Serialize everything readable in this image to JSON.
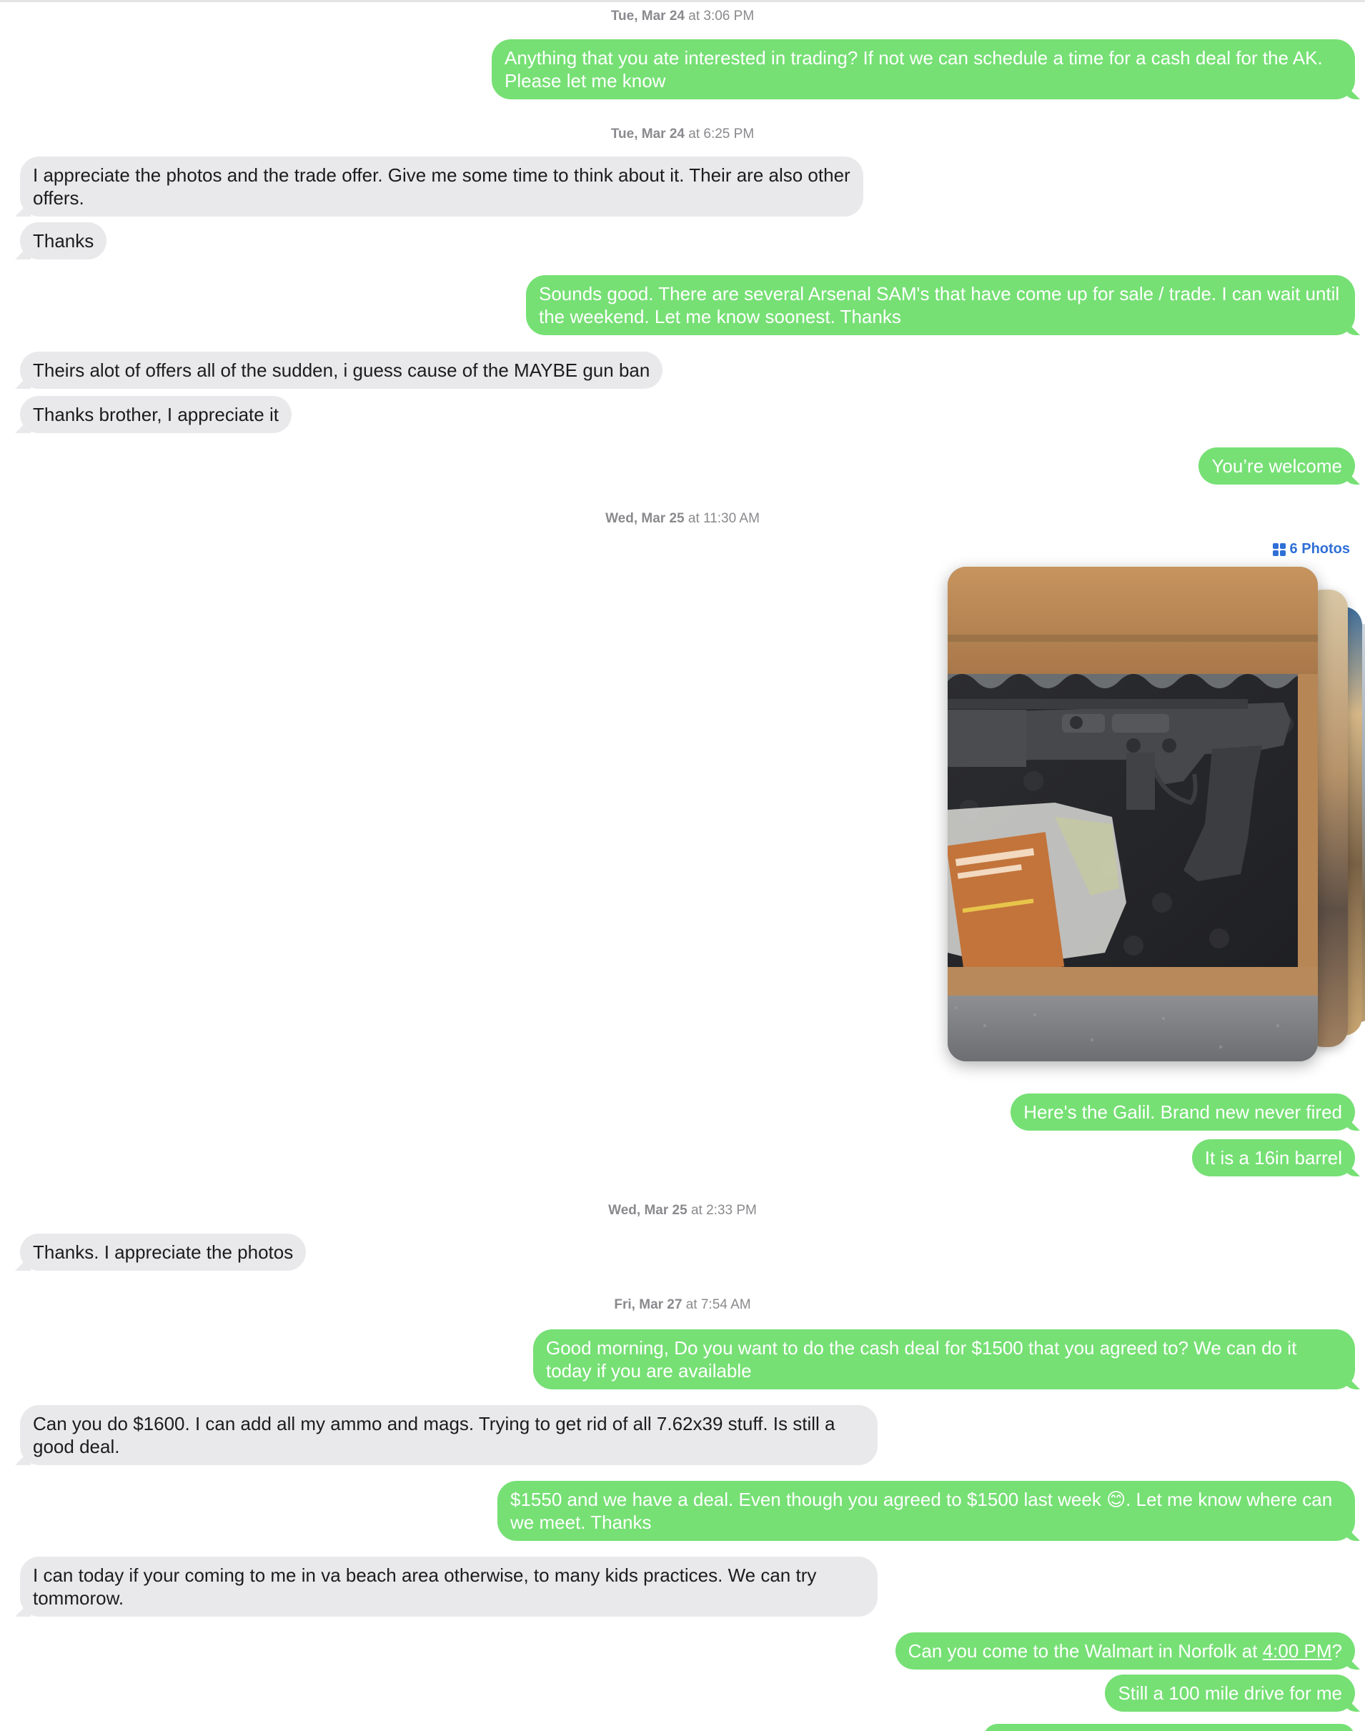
{
  "messages": [
    {
      "id": "ts1",
      "kind": "timestamp",
      "day": "Tue, Mar 24",
      "time": "at 3:06 PM"
    },
    {
      "id": "m1",
      "kind": "outgoing",
      "text": "Anything that you ate interested in trading? If not we can schedule a time for a cash deal for the AK. Please let me know"
    },
    {
      "id": "ts2",
      "kind": "timestamp",
      "day": "Tue, Mar 24",
      "time": "at 6:25 PM"
    },
    {
      "id": "m2",
      "kind": "incoming",
      "text": "I appreciate the photos and the trade offer. Give me some time to think about it. Their are also other offers."
    },
    {
      "id": "m3",
      "kind": "incoming",
      "text": "Thanks"
    },
    {
      "id": "m4",
      "kind": "outgoing",
      "text": "Sounds good. There are several Arsenal SAM's that have come up for sale / trade. I can wait until the weekend. Let me know soonest. Thanks"
    },
    {
      "id": "m5",
      "kind": "incoming",
      "text": "Theirs alot of offers all of the sudden, i guess cause of the MAYBE gun ban"
    },
    {
      "id": "m6",
      "kind": "incoming",
      "text": "Thanks brother, I appreciate it"
    },
    {
      "id": "m7",
      "kind": "outgoing",
      "text": "You’re welcome"
    },
    {
      "id": "ts3",
      "kind": "timestamp",
      "day": "Wed, Mar 25",
      "time": "at 11:30 AM"
    },
    {
      "id": "m8",
      "kind": "outgoing",
      "text": "Here's the Galil. Brand new never fired"
    },
    {
      "id": "m9",
      "kind": "outgoing",
      "text": "It is a 16in barrel"
    },
    {
      "id": "ts4",
      "kind": "timestamp",
      "day": "Wed, Mar 25",
      "time": "at 2:33 PM"
    },
    {
      "id": "m10",
      "kind": "incoming",
      "text": "Thanks. I appreciate the photos"
    },
    {
      "id": "ts5",
      "kind": "timestamp",
      "day": "Fri, Mar 27",
      "time": "at 7:54 AM"
    },
    {
      "id": "m11",
      "kind": "outgoing",
      "text": "Good morning, Do you want to do the cash deal for $1500 that you agreed to? We can do it today if you are available"
    },
    {
      "id": "m12",
      "kind": "incoming",
      "text": "Can you do $1600. I can add all my ammo and mags. Trying to get rid of all 7.62x39 stuff.  Is still a good deal."
    },
    {
      "id": "m13",
      "kind": "outgoing",
      "text": "$1550 and we have a deal. Even though you agreed to $1500 last week 😊. Let me know where can we meet. Thanks"
    },
    {
      "id": "m14",
      "kind": "incoming",
      "text": "I can today if your coming to me in va beach area otherwise, to many kids practices. We can try tommorow."
    },
    {
      "id": "m15",
      "kind": "outgoing",
      "text_before": "Can you come to the Walmart in Norfolk at ",
      "link": "4:00 PM",
      "text_after": "?"
    },
    {
      "id": "m16",
      "kind": "outgoing",
      "text": "Still a 100 mile drive for me"
    }
  ],
  "photo_group": {
    "label": "6 Photos",
    "icon": "grid-icon"
  },
  "colors": {
    "outgoing_bubble": "#76e074",
    "incoming_bubble": "#e9e9eb",
    "timestamp": "#8a8a8e",
    "link": "#2f6fd6"
  }
}
